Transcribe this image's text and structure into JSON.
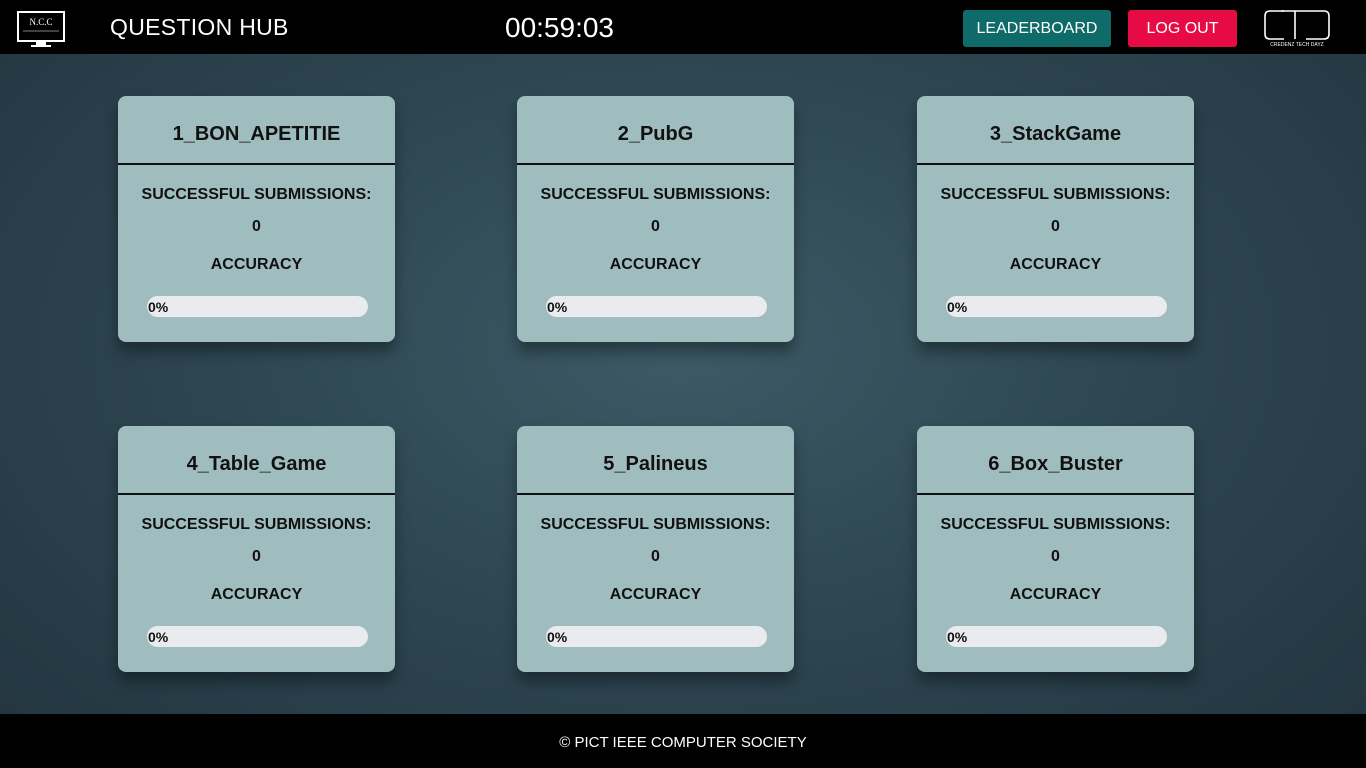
{
  "header": {
    "logo_left_text": "N.C.C",
    "title": "QUESTION HUB",
    "timer": "00:59:03",
    "leaderboard_label": "LEADERBOARD",
    "logout_label": "LOG OUT",
    "logo_right_text": "CREDENZ TECH DAYZ"
  },
  "colors": {
    "header_bg": "#000000",
    "card_bg": "#9fbcbf",
    "leaderboard_bg": "#0f6a6a",
    "logout_bg": "#e60b45",
    "progress_track": "#e9ebef"
  },
  "cards": [
    {
      "title": "1_BON_APETITIE",
      "submissions_label": "SUCCESSFUL SUBMISSIONS:",
      "submissions": "0",
      "accuracy_label": "ACCURACY",
      "accuracy_text": "0%",
      "accuracy_value": 0
    },
    {
      "title": "2_PubG",
      "submissions_label": "SUCCESSFUL SUBMISSIONS:",
      "submissions": "0",
      "accuracy_label": "ACCURACY",
      "accuracy_text": "0%",
      "accuracy_value": 0
    },
    {
      "title": "3_StackGame",
      "submissions_label": "SUCCESSFUL SUBMISSIONS:",
      "submissions": "0",
      "accuracy_label": "ACCURACY",
      "accuracy_text": "0%",
      "accuracy_value": 0
    },
    {
      "title": "4_Table_Game",
      "submissions_label": "SUCCESSFUL SUBMISSIONS:",
      "submissions": "0",
      "accuracy_label": "ACCURACY",
      "accuracy_text": "0%",
      "accuracy_value": 0
    },
    {
      "title": "5_Palineus",
      "submissions_label": "SUCCESSFUL SUBMISSIONS:",
      "submissions": "0",
      "accuracy_label": "ACCURACY",
      "accuracy_text": "0%",
      "accuracy_value": 0
    },
    {
      "title": "6_Box_Buster",
      "submissions_label": "SUCCESSFUL SUBMISSIONS:",
      "submissions": "0",
      "accuracy_label": "ACCURACY",
      "accuracy_text": "0%",
      "accuracy_value": 0
    }
  ],
  "footer": {
    "copyright": "© PICT IEEE COMPUTER SOCIETY"
  }
}
